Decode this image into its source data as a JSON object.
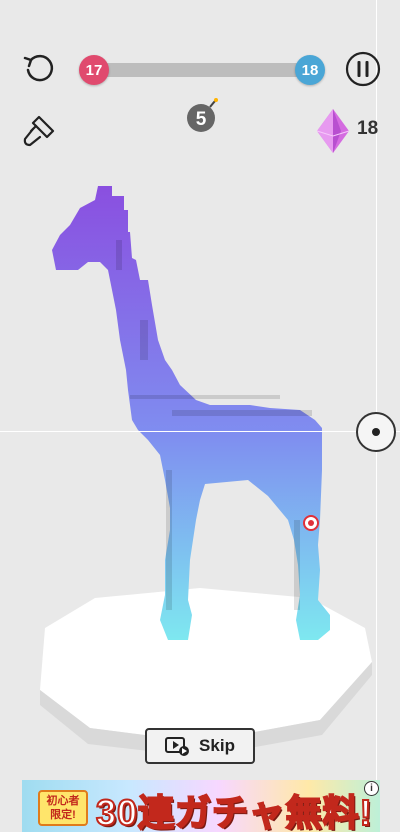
{
  "level": {
    "current": "17",
    "next": "18",
    "progress": 0.0
  },
  "bombs": {
    "count": "5"
  },
  "gems": {
    "count": "18"
  },
  "skip": {
    "label": "Skip"
  },
  "ad": {
    "tag_line1": "初心者",
    "tag_line2": "限定!",
    "headline": "30連ガチャ無料!",
    "info": "i"
  },
  "colors": {
    "current_level": "#e04a6e",
    "next_level": "#4aa6d6",
    "gem": "#d46be0",
    "model_top": "#8a4fe0",
    "model_bottom": "#7ee8f0"
  },
  "icons": {
    "restart": "restart-icon",
    "pause": "pause-icon",
    "paint": "paintbrush-icon",
    "bomb": "bomb-icon",
    "gem": "gem-icon",
    "target": "target-icon",
    "rotate": "rotate-handle-icon",
    "skip": "video-ad-icon"
  }
}
